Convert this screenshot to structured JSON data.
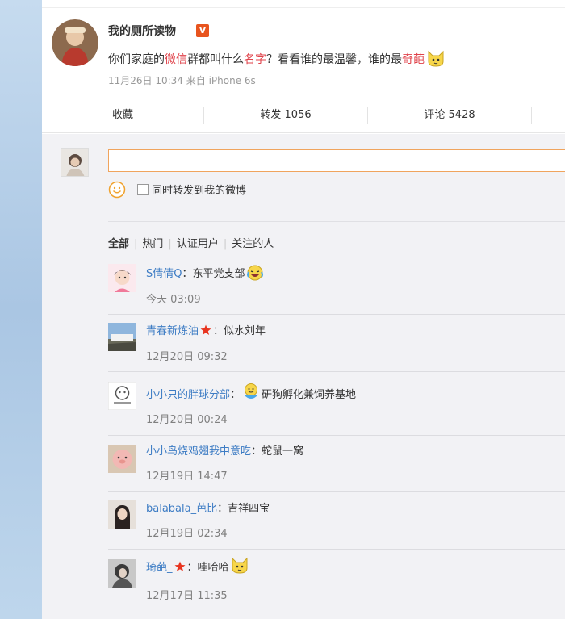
{
  "post": {
    "author": "我的厕所读物",
    "verified_badge": "V",
    "text_parts": [
      "你们家庭的",
      "微信",
      "群都叫什么",
      "名字",
      "？看看谁的最温馨，谁的最",
      "奇葩"
    ],
    "meta": "11月26日 10:34 来自 iPhone 6s"
  },
  "actions": {
    "favorite": "收藏",
    "repost": "转发 1056",
    "comment": "评论 5428"
  },
  "compose": {
    "input_value": "",
    "repost_checkbox_label": "同时转发到我的微博",
    "repost_checked": false
  },
  "filters": {
    "all": "全部",
    "hot": "热门",
    "verified": "认证用户",
    "following": "关注的人"
  },
  "comments": [
    {
      "name": "S倩倩Q",
      "text": "：东平党支部",
      "time": "今天 03:09",
      "star": false,
      "emoji": "laugh-cry"
    },
    {
      "name": "青春新炼油",
      "text": "：似水刘年",
      "time": "12月20日 09:32",
      "star": true
    },
    {
      "name": "小小只的胖球分部",
      "text": "研狗孵化兼饲养基地",
      "time": "12月20日 00:24",
      "star": false,
      "emoji": "smile-bowl"
    },
    {
      "name": "小小鸟烧鸡翅我中意吃",
      "text": "：蛇鼠一窝",
      "time": "12月19日 14:47",
      "star": false
    },
    {
      "name": "balabala_芭比",
      "text": "：吉祥四宝",
      "time": "12月19日 02:34",
      "star": false
    },
    {
      "name": "琦葩_",
      "text": "：哇哈哈",
      "time": "12月17日 11:35",
      "star": true,
      "emoji": "cat"
    }
  ],
  "colors": {
    "link": "#3d7cc4",
    "highlight": "#e0434b",
    "badge": "#e8541e",
    "input_border": "#f0a45d"
  }
}
